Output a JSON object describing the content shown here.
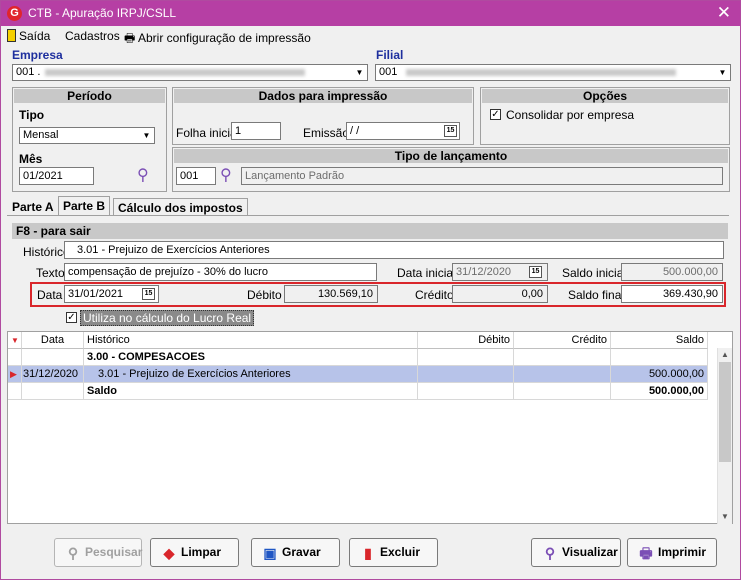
{
  "window": {
    "title": "CTB - Apuração IRPJ/CSLL",
    "logo": "G",
    "close": "✕"
  },
  "menu": {
    "saida": "Saída",
    "cadastros": "Cadastros",
    "config": "Abrir configuração de impressão"
  },
  "empresa": {
    "label": "Empresa",
    "value": "001 ."
  },
  "filial": {
    "label": "Filial",
    "value": "001"
  },
  "periodo": {
    "header": "Período",
    "tipo_label": "Tipo",
    "tipo_value": "Mensal",
    "mes_label": "Mês",
    "mes_value": "01/2021"
  },
  "dados_impressao": {
    "header": "Dados para impressão",
    "folha_label": "Folha inicial",
    "folha_value": "1",
    "emissao_label": "Emissão",
    "emissao_value": " / /"
  },
  "opcoes": {
    "header": "Opções",
    "consolidar_label": "Consolidar por empresa",
    "consolidar_checked": true
  },
  "tipo_lancamento": {
    "header": "Tipo de lançamento",
    "code": "001",
    "placeholder": "Lançamento Padrão"
  },
  "tabs": [
    "Parte A",
    "Parte B",
    "Cálculo dos impostos"
  ],
  "form": {
    "f8_label": "F8 - para sair",
    "historico_label": "Histórico",
    "historico_value": "3.01 - Prejuizo de Exercícios Anteriores",
    "texto_label": "Texto",
    "texto_value": "compensação de prejuízo - 30% do lucro",
    "data_inicial_label": "Data inicial",
    "data_inicial_value": "31/12/2020",
    "saldo_inicial_label": "Saldo inicial",
    "saldo_inicial_value": "500.000,00",
    "data_label": "Data",
    "data_value": "31/01/2021",
    "debito_label": "Débito",
    "debito_value": "130.569,10",
    "credito_label": "Crédito",
    "credito_value": "0,00",
    "saldo_final_label": "Saldo final",
    "saldo_final_value": "369.430,90",
    "lucro_real_label": "Utiliza no cálculo do Lucro Real",
    "lucro_real_checked": true
  },
  "grid": {
    "columns": [
      "Data",
      "Histórico",
      "Débito",
      "Crédito",
      "Saldo"
    ],
    "rows": [
      {
        "data": "",
        "historico": "3.00 - COMPESACOES",
        "debito": "",
        "credito": "",
        "saldo": ""
      },
      {
        "data": "31/12/2020",
        "historico": "3.01 - Prejuizo de Exercícios Anteriores",
        "debito": "",
        "credito": "",
        "saldo": "500.000,00"
      },
      {
        "data": "",
        "historico": "Saldo",
        "debito": "",
        "credito": "",
        "saldo": "500.000,00"
      }
    ]
  },
  "buttons": {
    "pesquisar": "Pesquisar",
    "limpar": "Limpar",
    "gravar": "Gravar",
    "excluir": "Excluir",
    "visualizar": "Visualizar",
    "imprimir": "Imprimir"
  },
  "calendar_icon": "15",
  "colors": {
    "titlebar": "#b63fa4",
    "label_blue": "#1e2f9e",
    "highlight_red": "#d9262b",
    "selected_row": "#b7c3e9"
  }
}
